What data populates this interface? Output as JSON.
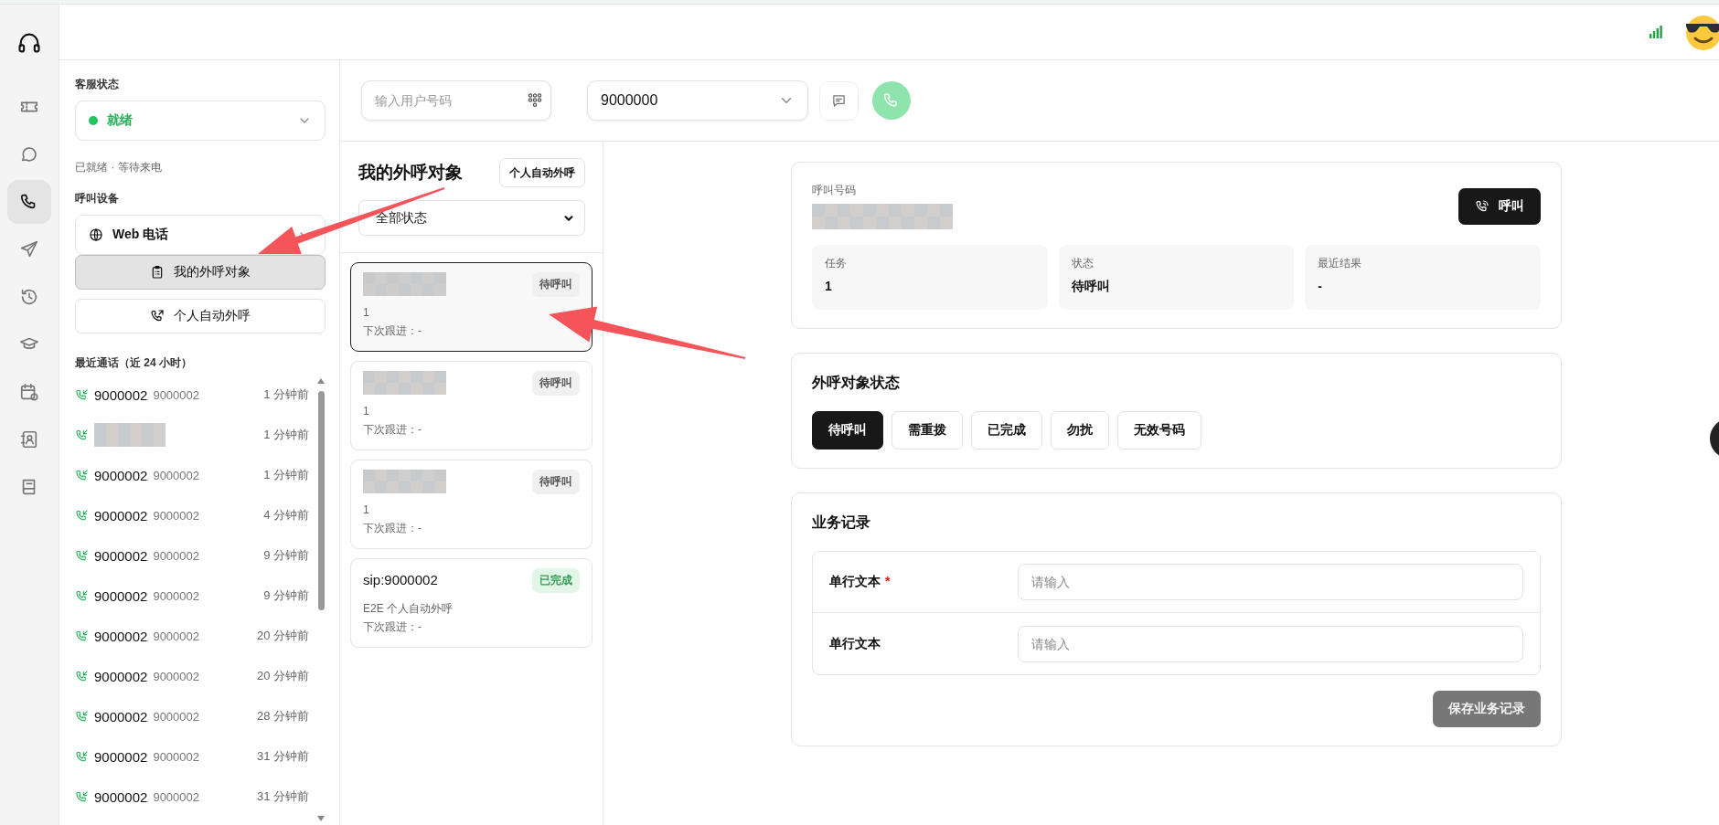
{
  "nav": [
    {
      "selected": false
    },
    {
      "selected": false
    },
    {
      "selected": true
    },
    {
      "selected": false
    },
    {
      "selected": false
    },
    {
      "selected": false
    },
    {
      "selected": false
    },
    {
      "selected": false
    },
    {
      "selected": false
    }
  ],
  "agent_panel": {
    "status_label": "客服状态",
    "status": "就绪",
    "status_hint": "已就绪 · 等待来电",
    "device_label": "呼叫设备",
    "device": "Web 电话",
    "actions": [
      {
        "label": "我的外呼对象",
        "selected": true
      },
      {
        "label": "个人自动外呼",
        "selected": false
      }
    ],
    "recent_title": "最近通话（近 24 小时）",
    "recent_calls": [
      {
        "redacted": false,
        "number": "9000002",
        "detail": "9000002",
        "time": "1 分钟前"
      },
      {
        "redacted": true,
        "time": "1 分钟前"
      },
      {
        "redacted": false,
        "number": "9000002",
        "detail": "9000002",
        "time": "1 分钟前"
      },
      {
        "redacted": false,
        "number": "9000002",
        "detail": "9000002",
        "time": "4 分钟前"
      },
      {
        "redacted": false,
        "number": "9000002",
        "detail": "9000002",
        "time": "9 分钟前"
      },
      {
        "redacted": false,
        "number": "9000002",
        "detail": "9000002",
        "time": "9 分钟前"
      },
      {
        "redacted": false,
        "number": "9000002",
        "detail": "9000002",
        "time": "20 分钟前"
      },
      {
        "redacted": false,
        "number": "9000002",
        "detail": "9000002",
        "time": "20 分钟前"
      },
      {
        "redacted": false,
        "number": "9000002",
        "detail": "9000002",
        "time": "28 分钟前"
      },
      {
        "redacted": false,
        "number": "9000002",
        "detail": "9000002",
        "time": "31 分钟前"
      },
      {
        "redacted": false,
        "number": "9000002",
        "detail": "9000002",
        "time": "31 分钟前"
      }
    ]
  },
  "dialer": {
    "placeholder": "输入用户号码",
    "caller_id": "9000000"
  },
  "targets": {
    "title": "我的外呼对象",
    "action": "个人自动外呼",
    "filter": "全部状态",
    "items": [
      {
        "kind": "pending",
        "redacted": true,
        "task": "1",
        "next": "下次跟进：-",
        "status": "待呼叫",
        "selected": true
      },
      {
        "kind": "pending",
        "redacted": true,
        "task": "1",
        "next": "下次跟进：-",
        "status": "待呼叫",
        "selected": false
      },
      {
        "kind": "pending",
        "redacted": true,
        "task": "1",
        "next": "下次跟进：-",
        "status": "待呼叫",
        "selected": false
      },
      {
        "kind": "done",
        "redacted": false,
        "name": "sip:9000002",
        "task": "E2E 个人自动外呼",
        "next": "下次跟进：-",
        "status": "已完成",
        "selected": false
      }
    ]
  },
  "detail": {
    "number_label": "呼叫号码",
    "number_redacted": true,
    "call_button": "呼叫",
    "facts": [
      {
        "label": "任务",
        "value": "1"
      },
      {
        "label": "状态",
        "value": "待呼叫"
      },
      {
        "label": "最近结果",
        "value": "-"
      }
    ],
    "status_title": "外呼对象状态",
    "statuses": [
      {
        "label": "待呼叫",
        "selected": true
      },
      {
        "label": "需重拨",
        "selected": false
      },
      {
        "label": "已完成",
        "selected": false
      },
      {
        "label": "勿扰",
        "selected": false
      },
      {
        "label": "无效号码",
        "selected": false
      }
    ],
    "record_title": "业务记录",
    "fields": [
      {
        "label": "单行文本",
        "required_mark": "*",
        "placeholder": "请输入"
      },
      {
        "label": "单行文本",
        "placeholder": "请输入"
      }
    ],
    "save_button": "保存业务记录",
    "save_disabled": true
  }
}
